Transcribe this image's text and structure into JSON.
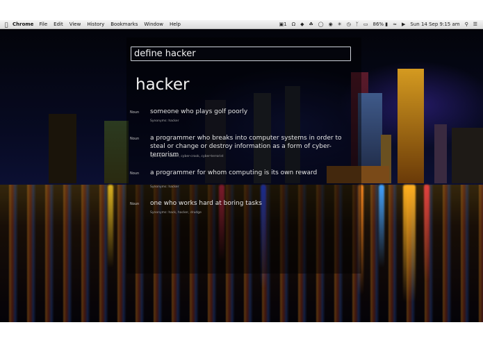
{
  "menubar": {
    "apple_icon": "apple-icon",
    "app_name": "Chrome",
    "menus": [
      "File",
      "Edit",
      "View",
      "History",
      "Bookmarks",
      "Window",
      "Help"
    ],
    "status": {
      "badge_count": "1",
      "battery": "86%",
      "datetime": "Sun 14 Sep  9:15 am"
    }
  },
  "search": {
    "query": "define hacker"
  },
  "definition": {
    "word": "hacker",
    "senses": [
      {
        "pos": "Noun",
        "text": "someone who plays golf poorly",
        "synonyms": "Synonyms: hacker"
      },
      {
        "pos": "Noun",
        "text": "a programmer who breaks into computer systems in order to steal or change or destroy information as a form of cyber-terrorism",
        "synonyms": "Synonyms: hacker, cyber-crook, cyber-terrorist"
      },
      {
        "pos": "Noun",
        "text": "a programmer for whom computing is its own reward",
        "synonyms": "Synonyms: hacker"
      },
      {
        "pos": "Noun",
        "text": "one who works hard at boring tasks",
        "synonyms": "Synonyms: hack, hacker, drudge"
      }
    ]
  }
}
